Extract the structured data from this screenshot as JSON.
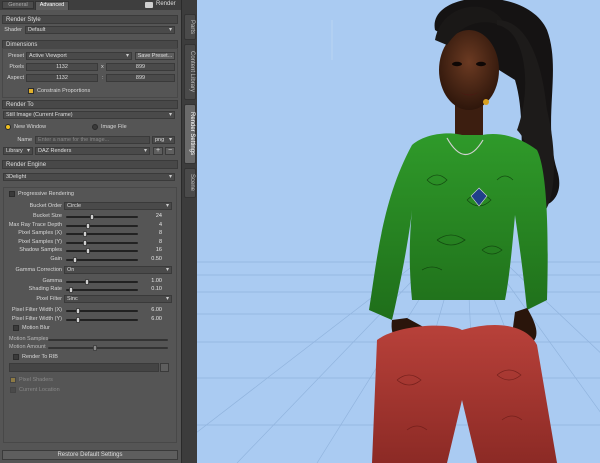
{
  "tabs": {
    "general": "General",
    "advanced": "Advanced",
    "render": "Render"
  },
  "render_style": {
    "header": "Render Style",
    "shader_label": "Shader",
    "shader_value": "Default"
  },
  "dimensions": {
    "header": "Dimensions",
    "preset_label": "Preset",
    "preset_value": "Active Viewport",
    "save_preset": "Save Preset...",
    "pixels_label": "Pixels",
    "pixels_w": "1132",
    "pixels_h": "899",
    "x_sep": "x",
    "aspect_label": "Aspect",
    "aspect_w": "1132",
    "aspect_h": "899",
    "colon_sep": ":",
    "constrain": "Constrain Proportions"
  },
  "render_to": {
    "header": "Render To",
    "target_value": "Still Image (Current Frame)",
    "new_window": "New Window",
    "image_file": "Image File",
    "name_label": "Name",
    "name_placeholder": "Enter a name for the image...",
    "format": "png",
    "library_label": "Library",
    "library_value": "DAZ Renders"
  },
  "render_engine": {
    "header": "Render Engine",
    "engine_value": "3Delight",
    "progressive": "Progressive Rendering",
    "bucket_order_label": "Bucket Order",
    "bucket_order_value": "Circle",
    "sliders": [
      {
        "label": "Bucket Size",
        "value": "24",
        "fill": 0.35
      },
      {
        "label": "Max Ray Trace Depth",
        "value": "4",
        "fill": 0.3
      },
      {
        "label": "Pixel Samples (X)",
        "value": "8",
        "fill": 0.25
      },
      {
        "label": "Pixel Samples (Y)",
        "value": "8",
        "fill": 0.25
      },
      {
        "label": "Shadow Samples",
        "value": "16",
        "fill": 0.3
      },
      {
        "label": "Gain",
        "value": "0.50",
        "fill": 0.1
      }
    ],
    "gamma_correction_label": "Gamma Correction",
    "gamma_correction_value": "On",
    "sliders2": [
      {
        "label": "Gamma",
        "value": "1.00",
        "fill": 0.28
      },
      {
        "label": "Shading Rate",
        "value": "0.10",
        "fill": 0.05
      }
    ],
    "pixel_filter_label": "Pixel Filter",
    "pixel_filter_value": "Sinc",
    "sliders3": [
      {
        "label": "Pixel Filter Width (X)",
        "value": "6.00",
        "fill": 0.15
      },
      {
        "label": "Pixel Filter Width (Y)",
        "value": "6.00",
        "fill": 0.15
      }
    ],
    "motion_blur": "Motion Blur",
    "motion_samples": "Motion Samples",
    "motion_amount": "Motion Amount",
    "render_to_rib": "Render To RIB",
    "pixel_shaders": "Pixel Shaders",
    "current_location": "Current Location"
  },
  "restore_button": "Restore Default Settings",
  "side_tabs": [
    "Parts",
    "Content Library",
    "Render Settings",
    "Scene"
  ]
}
